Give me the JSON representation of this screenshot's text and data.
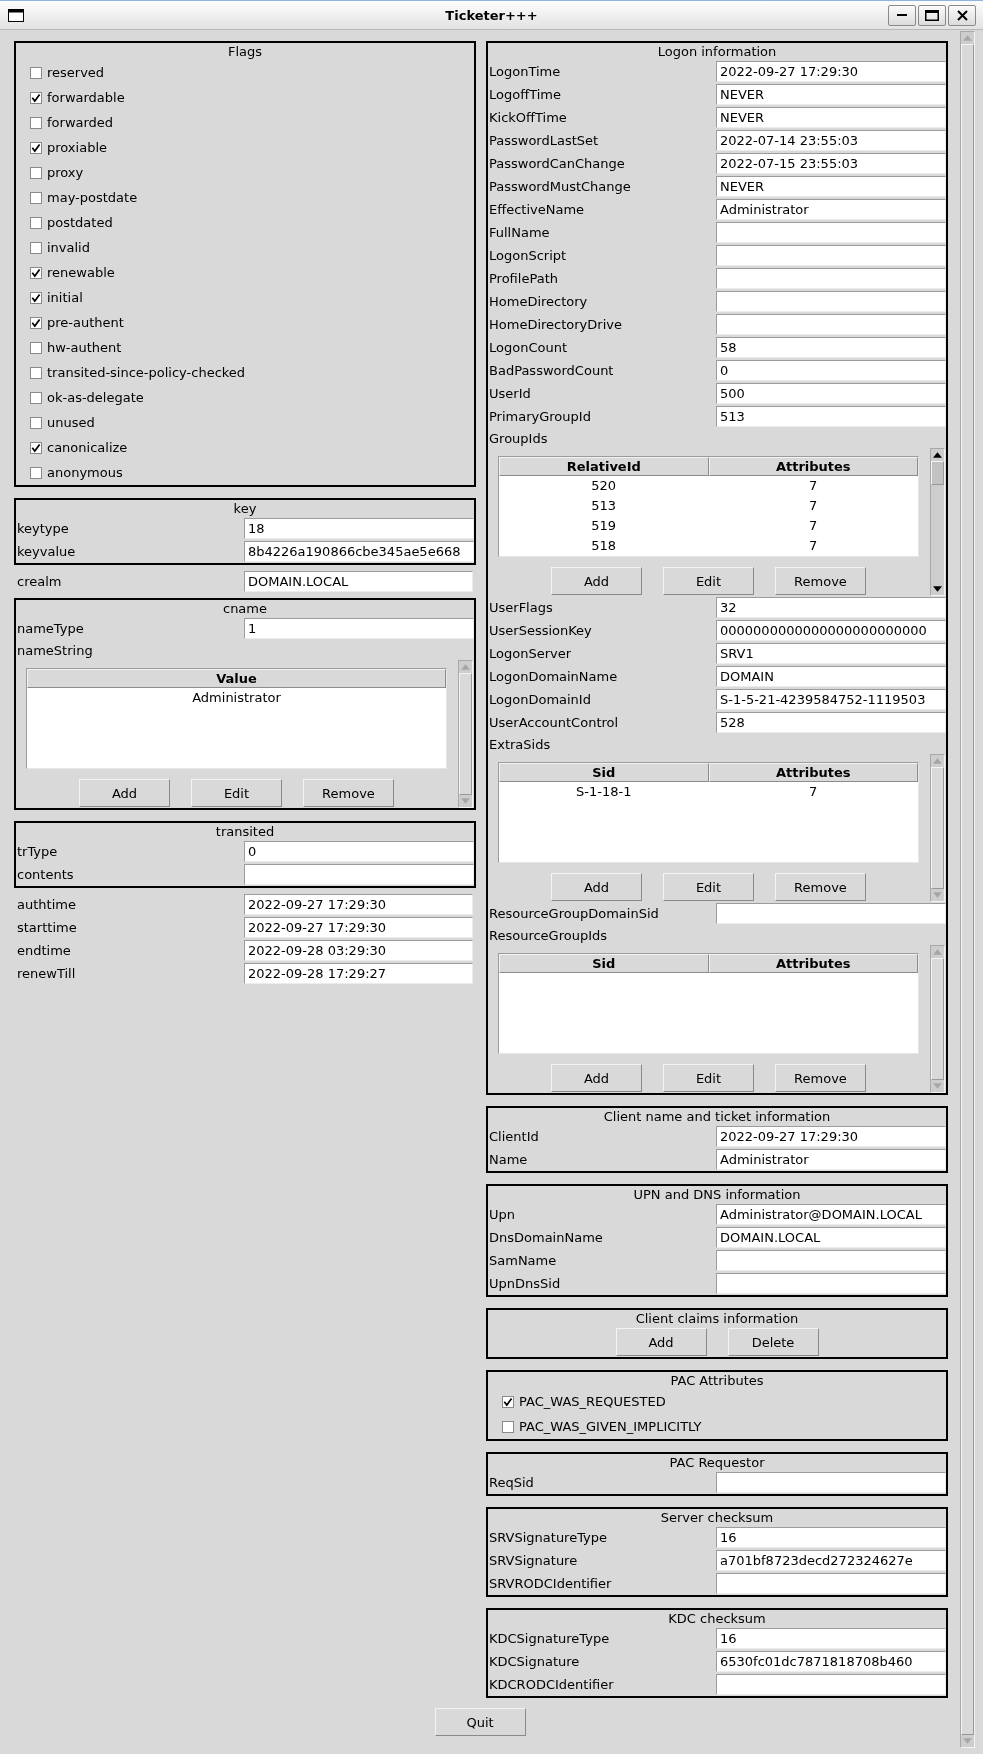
{
  "window": {
    "title": "Ticketer+++"
  },
  "left_column": [
    {
      "kind": "group",
      "title": "Flags",
      "items": [
        {
          "kind": "checkbox",
          "label": "reserved",
          "checked": false
        },
        {
          "kind": "checkbox",
          "label": "forwardable",
          "checked": true
        },
        {
          "kind": "checkbox",
          "label": "forwarded",
          "checked": false
        },
        {
          "kind": "checkbox",
          "label": "proxiable",
          "checked": true
        },
        {
          "kind": "checkbox",
          "label": "proxy",
          "checked": false
        },
        {
          "kind": "checkbox",
          "label": "may-postdate",
          "checked": false
        },
        {
          "kind": "checkbox",
          "label": "postdated",
          "checked": false
        },
        {
          "kind": "checkbox",
          "label": "invalid",
          "checked": false
        },
        {
          "kind": "checkbox",
          "label": "renewable",
          "checked": true
        },
        {
          "kind": "checkbox",
          "label": "initial",
          "checked": true
        },
        {
          "kind": "checkbox",
          "label": "pre-authent",
          "checked": true
        },
        {
          "kind": "checkbox",
          "label": "hw-authent",
          "checked": false
        },
        {
          "kind": "checkbox",
          "label": "transited-since-policy-checked",
          "checked": false
        },
        {
          "kind": "checkbox",
          "label": "ok-as-delegate",
          "checked": false
        },
        {
          "kind": "checkbox",
          "label": "unused",
          "checked": false
        },
        {
          "kind": "checkbox",
          "label": "canonicalize",
          "checked": true
        },
        {
          "kind": "checkbox",
          "label": "anonymous",
          "checked": false
        }
      ]
    },
    {
      "kind": "group",
      "title": "key",
      "items": [
        {
          "kind": "field",
          "label": "keytype",
          "value": "18"
        },
        {
          "kind": "field",
          "label": "keyvalue",
          "value": "8b4226a190866cbe345ae5e668"
        }
      ]
    },
    {
      "kind": "field",
      "label": "crealm",
      "value": "DOMAIN.LOCAL"
    },
    {
      "kind": "group",
      "title": "cname",
      "items": [
        {
          "kind": "field",
          "label": "nameType",
          "value": "1"
        },
        {
          "kind": "list",
          "label": "nameString",
          "columns": [
            "Value"
          ],
          "rows": [
            [
              "Administrator"
            ]
          ],
          "buttons": [
            "Add",
            "Edit",
            "Remove"
          ]
        }
      ]
    },
    {
      "kind": "group",
      "title": "transited",
      "items": [
        {
          "kind": "field",
          "label": "trType",
          "value": "0"
        },
        {
          "kind": "field",
          "label": "contents"
        }
      ]
    },
    {
      "kind": "field",
      "label": "authtime",
      "value": "2022-09-27 17:29:30"
    },
    {
      "kind": "field",
      "label": "starttime",
      "value": "2022-09-27 17:29:30"
    },
    {
      "kind": "field",
      "label": "endtime",
      "value": "2022-09-28 03:29:30"
    },
    {
      "kind": "field",
      "label": "renewTill",
      "value": "2022-09-28 17:29:27"
    }
  ],
  "right_column": [
    {
      "kind": "group",
      "title": "Logon information",
      "items": [
        {
          "kind": "field",
          "label": "LogonTime",
          "value": "2022-09-27 17:29:30"
        },
        {
          "kind": "field",
          "label": "LogoffTime",
          "value": "NEVER"
        },
        {
          "kind": "field",
          "label": "KickOffTime",
          "value": "NEVER"
        },
        {
          "kind": "field",
          "label": "PasswordLastSet",
          "value": "2022-07-14 23:55:03"
        },
        {
          "kind": "field",
          "label": "PasswordCanChange",
          "value": "2022-07-15 23:55:03"
        },
        {
          "kind": "field",
          "label": "PasswordMustChange",
          "value": "NEVER"
        },
        {
          "kind": "field",
          "label": "EffectiveName",
          "value": "Administrator"
        },
        {
          "kind": "field",
          "label": "FullName"
        },
        {
          "kind": "field",
          "label": "LogonScript"
        },
        {
          "kind": "field",
          "label": "ProfilePath"
        },
        {
          "kind": "field",
          "label": "HomeDirectory"
        },
        {
          "kind": "field",
          "label": "HomeDirectoryDrive"
        },
        {
          "kind": "field",
          "label": "LogonCount",
          "value": "58"
        },
        {
          "kind": "field",
          "label": "BadPasswordCount",
          "value": "0"
        },
        {
          "kind": "field",
          "label": "UserId",
          "value": "500"
        },
        {
          "kind": "field",
          "label": "PrimaryGroupId",
          "value": "513"
        },
        {
          "kind": "list",
          "label": "GroupIds",
          "columns": [
            "RelativeId",
            "Attributes"
          ],
          "rows": [
            [
              "520",
              "7"
            ],
            [
              "513",
              "7"
            ],
            [
              "519",
              "7"
            ],
            [
              "518",
              "7"
            ]
          ],
          "buttons": [
            "Add",
            "Edit",
            "Remove"
          ]
        },
        {
          "kind": "field",
          "label": "UserFlags",
          "value": "32"
        },
        {
          "kind": "field",
          "label": "UserSessionKey",
          "value": "0000000000000000000000000"
        },
        {
          "kind": "field",
          "label": "LogonServer",
          "value": "SRV1"
        },
        {
          "kind": "field",
          "label": "LogonDomainName",
          "value": "DOMAIN"
        },
        {
          "kind": "field",
          "label": "LogonDomainId",
          "value": "S-1-5-21-4239584752-1119503"
        },
        {
          "kind": "field",
          "label": "UserAccountControl",
          "value": "528"
        },
        {
          "kind": "list",
          "label": "ExtraSids",
          "columns": [
            "Sid",
            "Attributes"
          ],
          "rows": [
            [
              "S-1-18-1",
              "7"
            ]
          ],
          "buttons": [
            "Add",
            "Edit",
            "Remove"
          ]
        },
        {
          "kind": "field",
          "label": "ResourceGroupDomainSid"
        },
        {
          "kind": "list",
          "label": "ResourceGroupIds",
          "columns": [
            "Sid",
            "Attributes"
          ],
          "buttons": [
            "Add",
            "Edit",
            "Remove"
          ]
        }
      ]
    },
    {
      "kind": "group",
      "title": "Client name and ticket information",
      "items": [
        {
          "kind": "field",
          "label": "ClientId",
          "value": "2022-09-27 17:29:30"
        },
        {
          "kind": "field",
          "label": "Name",
          "value": "Administrator"
        }
      ]
    },
    {
      "kind": "group",
      "title": "UPN and DNS information",
      "items": [
        {
          "kind": "field",
          "label": "Upn",
          "value": "Administrator@DOMAIN.LOCAL"
        },
        {
          "kind": "field",
          "label": "DnsDomainName",
          "value": "DOMAIN.LOCAL"
        },
        {
          "kind": "field",
          "label": "SamName"
        },
        {
          "kind": "field",
          "label": "UpnDnsSid"
        }
      ]
    },
    {
      "kind": "group",
      "title": "Client claims information",
      "items": [
        {
          "kind": "buttons",
          "buttons": [
            "Add",
            "Delete"
          ]
        }
      ]
    },
    {
      "kind": "group",
      "title": "PAC Attributes",
      "items": [
        {
          "kind": "checkbox",
          "label": "PAC_WAS_REQUESTED",
          "checked": true
        },
        {
          "kind": "checkbox",
          "label": "PAC_WAS_GIVEN_IMPLICITLY",
          "checked": false
        }
      ]
    },
    {
      "kind": "group",
      "title": "PAC Requestor",
      "items": [
        {
          "kind": "field",
          "label": "ReqSid"
        }
      ]
    },
    {
      "kind": "group",
      "title": "Server checksum",
      "items": [
        {
          "kind": "field",
          "label": "SRVSignatureType",
          "value": "16"
        },
        {
          "kind": "field",
          "label": "SRVSignature",
          "value": "a701bf8723decd272324627e"
        },
        {
          "kind": "field",
          "label": "SRVRODCIdentifier"
        }
      ]
    },
    {
      "kind": "group",
      "title": "KDC checksum",
      "items": [
        {
          "kind": "field",
          "label": "KDCSignatureType",
          "value": "16"
        },
        {
          "kind": "field",
          "label": "KDCSignature",
          "value": "6530fc01dc7871818708b460"
        },
        {
          "kind": "field",
          "label": "KDCRODCIdentifier"
        }
      ]
    }
  ],
  "quit_button": {
    "label": "Quit"
  }
}
